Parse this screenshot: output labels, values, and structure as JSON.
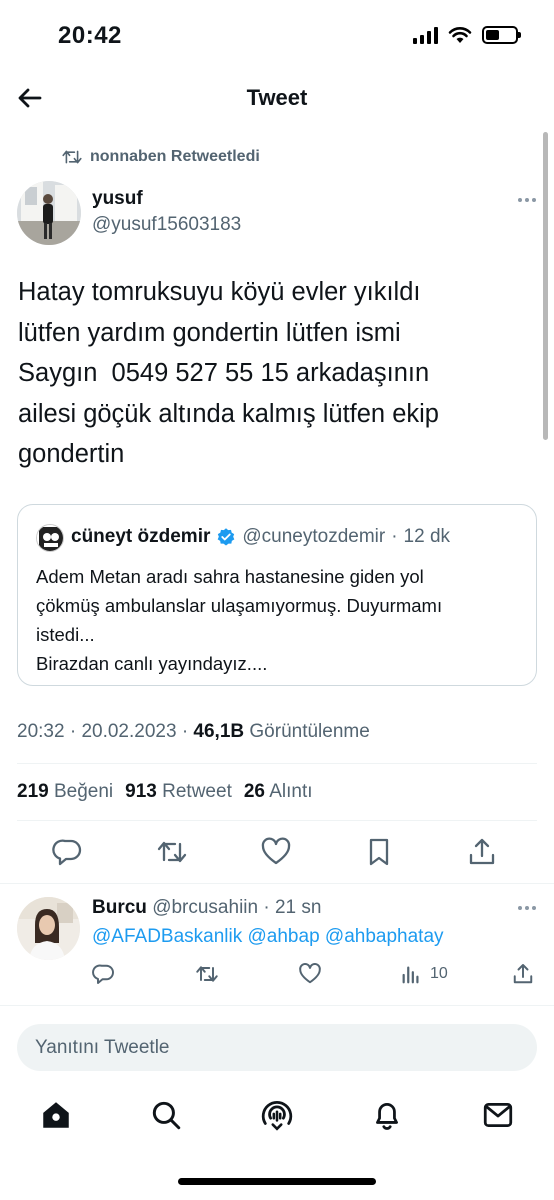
{
  "status_bar": {
    "time": "20:42",
    "battery_level": 0.45
  },
  "header": {
    "title": "Tweet"
  },
  "social_context": {
    "text": "nonnaben Retweetledi"
  },
  "tweet": {
    "author_name": "yusuf",
    "author_handle": "@yusuf15603183",
    "text_lines": [
      "Hatay tomruksuyu köyü evler yıkıldı",
      "lütfen yardım gondertin lütfen ismi",
      "Saygın  0549 527 55 15 arkadaşının",
      "ailesi göçük altında kalmış lütfen ekip",
      "gondertin"
    ],
    "time": "20:32",
    "date": "20.02.2023",
    "views_count": "46,1B",
    "views_label": "Görüntülenme",
    "likes_count": "219",
    "likes_label": "Beğeni",
    "retweets_count": "913",
    "retweets_label": "Retweet",
    "quotes_count": "26",
    "quotes_label": "Alıntı"
  },
  "quoted_tweet": {
    "author_name": "cüneyt özdemir",
    "author_handle": "@cuneytozdemir",
    "age": "12 dk",
    "text_lines": [
      "Adem Metan aradı sahra hastanesine giden yol",
      "çökmüş ambulanslar ulaşamıyormuş. Duyurmamı",
      "istedi...",
      "Birazdan canlı yayındayız...."
    ],
    "verified_color": "#1d9bf0"
  },
  "reply": {
    "author_name": "Burcu",
    "author_handle": "@brcusahiin",
    "age": "21 sn",
    "mentions": [
      "@AFADBaskanlik",
      "@ahbap",
      "@ahbaphatay"
    ],
    "views_count": "10"
  },
  "reply_input": {
    "placeholder": "Yanıtını Tweetle"
  },
  "colors": {
    "link": "#1d9bf0",
    "secondary_text": "#536471",
    "primary_text": "#0f1419",
    "border": "#cfd9de"
  },
  "icons": {
    "header": [
      "back-arrow-icon"
    ],
    "tweet_actions": [
      "reply-icon",
      "retweet-icon",
      "like-icon",
      "bookmark-icon",
      "share-icon"
    ],
    "tabs": [
      "home-icon",
      "search-icon",
      "spaces-icon",
      "notifications-icon",
      "messages-icon"
    ]
  }
}
